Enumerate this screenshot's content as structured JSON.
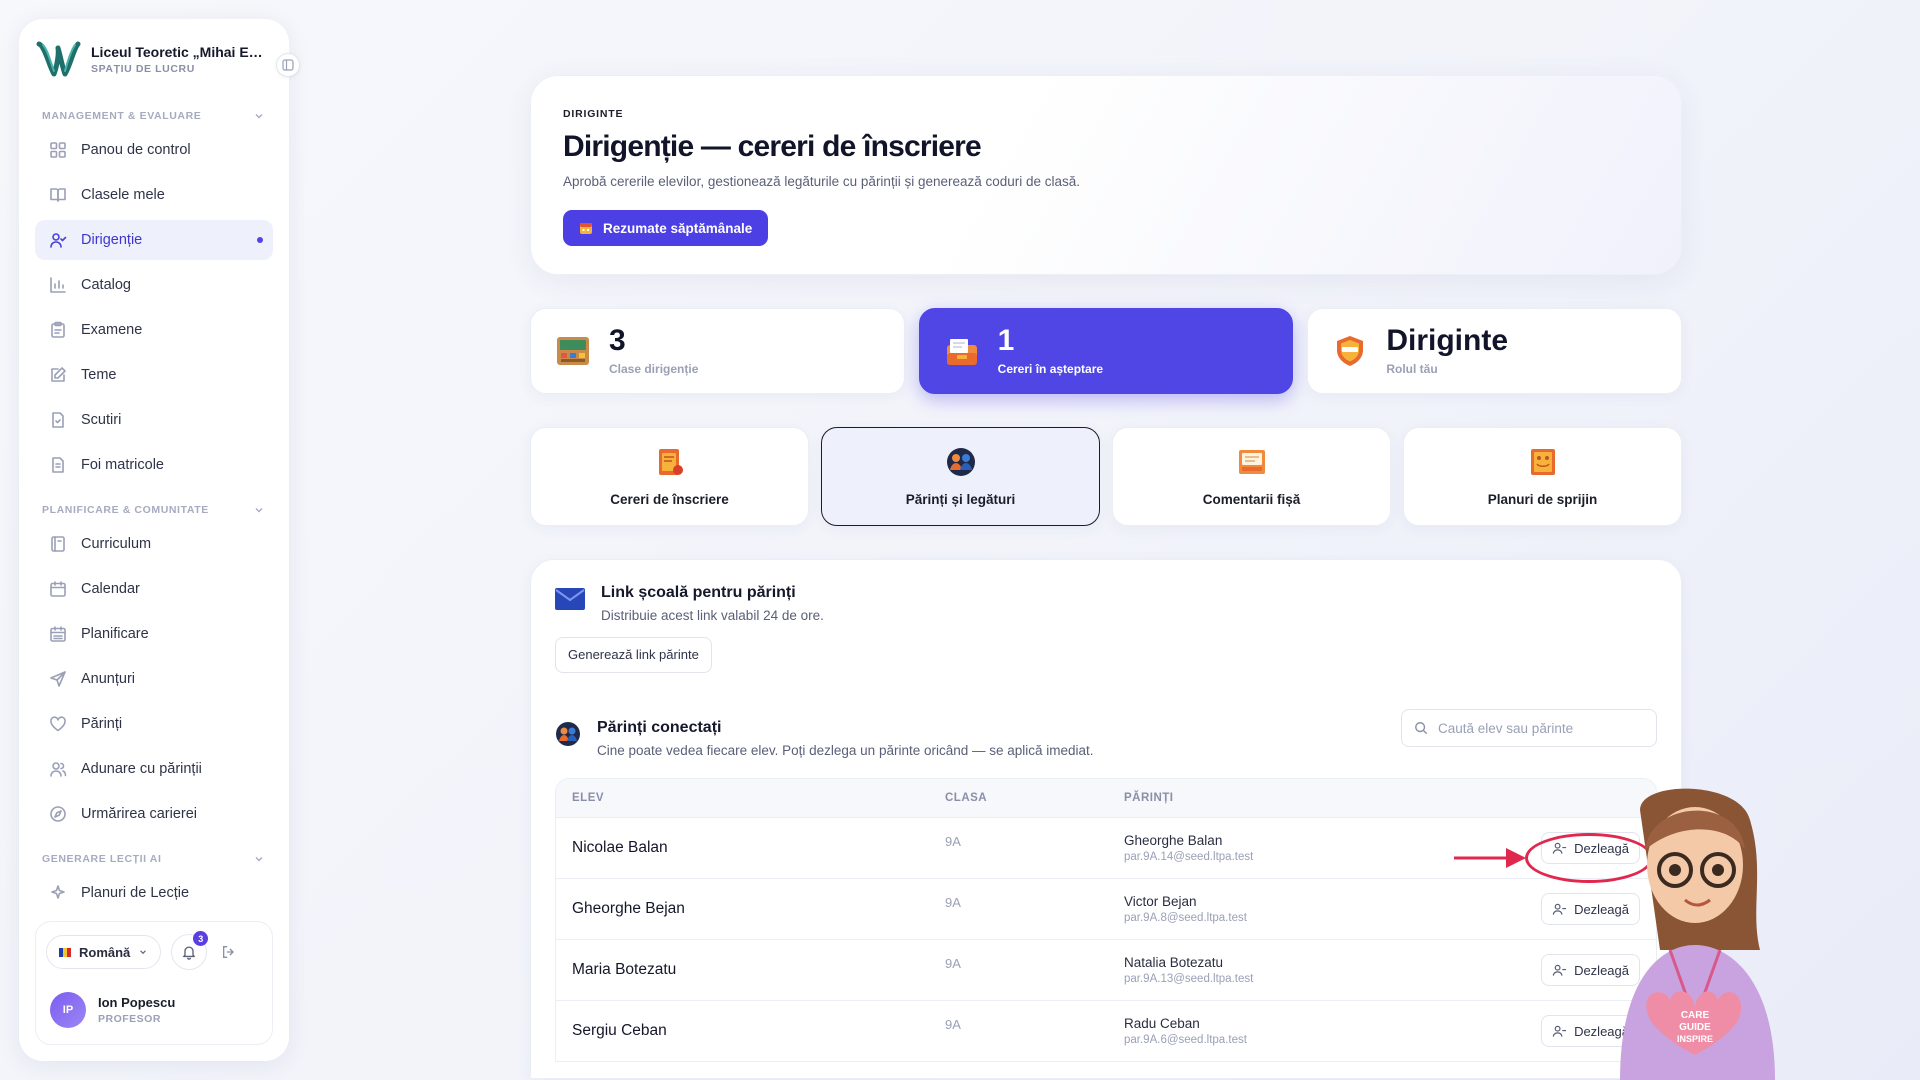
{
  "sidebar": {
    "school_name": "Liceul Teoretic „Mihai Emi...",
    "workspace": "SPAȚIU DE LUCRU",
    "sections": [
      {
        "title": "MANAGEMENT & EVALUARE",
        "items": [
          {
            "label": "Panou de control",
            "icon": "dashboard-icon"
          },
          {
            "label": "Clasele mele",
            "icon": "book-icon"
          },
          {
            "label": "Dirigenție",
            "icon": "user-check-icon",
            "active": true
          },
          {
            "label": "Catalog",
            "icon": "bar-chart-icon"
          },
          {
            "label": "Examene",
            "icon": "clipboard-icon"
          },
          {
            "label": "Teme",
            "icon": "edit-icon"
          },
          {
            "label": "Scutiri",
            "icon": "file-check-icon"
          },
          {
            "label": "Foi matricole",
            "icon": "file-text-icon"
          }
        ]
      },
      {
        "title": "PLANIFICARE & COMUNITATE",
        "items": [
          {
            "label": "Curriculum",
            "icon": "notebook-icon"
          },
          {
            "label": "Calendar",
            "icon": "calendar-icon"
          },
          {
            "label": "Planificare",
            "icon": "calendar-grid-icon"
          },
          {
            "label": "Anunțuri",
            "icon": "send-icon"
          },
          {
            "label": "Părinți",
            "icon": "heart-icon"
          },
          {
            "label": "Adunare cu părinții",
            "icon": "users-icon"
          },
          {
            "label": "Urmărirea carierei",
            "icon": "compass-icon"
          }
        ]
      },
      {
        "title": "GENERARE LECȚII AI",
        "items": [
          {
            "label": "Planuri de Lecție",
            "icon": "sparkles-icon"
          }
        ]
      }
    ],
    "language": "Română",
    "notifications_count": "3",
    "user": {
      "initials": "IP",
      "name": "Ion Popescu",
      "role": "PROFESOR"
    }
  },
  "hero": {
    "eyebrow": "DIRIGINTE",
    "title": "Dirigenție — cereri de înscriere",
    "description": "Aprobă cererile elevilor, gestionează legăturile cu părinții și generează coduri de clasă.",
    "button_label": "Rezumate săptămânale"
  },
  "stats": [
    {
      "value": "3",
      "label": "Clase dirigenție",
      "icon": "classroom-icon"
    },
    {
      "value": "1",
      "label": "Cereri în așteptare",
      "icon": "inbox-icon",
      "highlighted": true
    },
    {
      "value": "Diriginte",
      "label": "Rolul tău",
      "icon": "shield-icon"
    }
  ],
  "tabs": [
    {
      "label": "Cereri de înscriere",
      "icon": "application-icon"
    },
    {
      "label": "Părinți și legături",
      "icon": "family-icon",
      "active": true
    },
    {
      "label": "Comentarii fișă",
      "icon": "comment-sheet-icon"
    },
    {
      "label": "Planuri de sprijin",
      "icon": "support-plan-icon"
    }
  ],
  "school_link": {
    "title": "Link școală pentru părinți",
    "description": "Distribuie acest link valabil 24 de ore.",
    "button_label": "Generează link părinte"
  },
  "connected": {
    "title": "Părinți conectați",
    "description": "Cine poate vedea fiecare elev. Poți dezlega un părinte oricând — se aplică imediat.",
    "search_placeholder": "Caută elev sau părinte",
    "columns": [
      "ELEV",
      "CLASA",
      "PĂRINȚI"
    ],
    "action_label": "Dezleagă",
    "rows": [
      {
        "student": "Nicolae Balan",
        "class": "9A",
        "parent": "Gheorghe Balan",
        "email": "par.9A.14@seed.ltpa.test"
      },
      {
        "student": "Gheorghe Bejan",
        "class": "9A",
        "parent": "Victor Bejan",
        "email": "par.9A.8@seed.ltpa.test"
      },
      {
        "student": "Maria Botezatu",
        "class": "9A",
        "parent": "Natalia Botezatu",
        "email": "par.9A.13@seed.ltpa.test"
      },
      {
        "student": "Sergiu Ceban",
        "class": "9A",
        "parent": "Radu Ceban",
        "email": "par.9A.6@seed.ltpa.test"
      }
    ]
  },
  "mascot_badge": [
    "CARE",
    "GUIDE",
    "INSPIRE"
  ],
  "colors": {
    "accent": "#4f46e5",
    "annotation": "#e0284f"
  }
}
